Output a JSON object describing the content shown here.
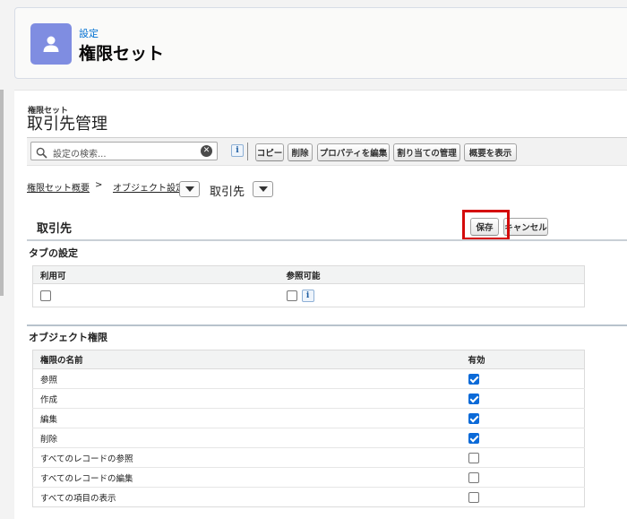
{
  "header": {
    "breadcrumb": "設定",
    "title": "権限セット",
    "icon": "user-icon"
  },
  "permission_set": {
    "label": "権限セット",
    "name": "取引先管理"
  },
  "toolbar": {
    "search_placeholder": "設定の検索...",
    "info": "i",
    "copy": "コピー",
    "delete": "削除",
    "edit_properties": "プロパティを編集",
    "manage_assignments": "割り当ての管理",
    "view_summary": "概要を表示"
  },
  "breadcrumbs": {
    "overview": "権限セット概要",
    "separator": ">",
    "object_settings": "オブジェクト設定",
    "current": "取引先"
  },
  "object_section": {
    "title": "取引先",
    "save": "保存",
    "cancel": "キャンセル"
  },
  "tab_settings": {
    "title": "タブの設定",
    "columns": [
      "利用可",
      "参照可能"
    ],
    "available": false,
    "visible": false,
    "info": "i"
  },
  "object_permissions": {
    "title": "オブジェクト権限",
    "columns": [
      "権限の名前",
      "有効"
    ],
    "rows": [
      {
        "name": "参照",
        "enabled": true
      },
      {
        "name": "作成",
        "enabled": true
      },
      {
        "name": "編集",
        "enabled": true
      },
      {
        "name": "削除",
        "enabled": true
      },
      {
        "name": "すべてのレコードの参照",
        "enabled": false
      },
      {
        "name": "すべてのレコードの編集",
        "enabled": false
      },
      {
        "name": "すべての項目の表示",
        "enabled": false
      }
    ]
  },
  "colors": {
    "accent": "#0b6ad8",
    "header_icon": "#7f8de1",
    "highlight": "#d40b0b"
  }
}
